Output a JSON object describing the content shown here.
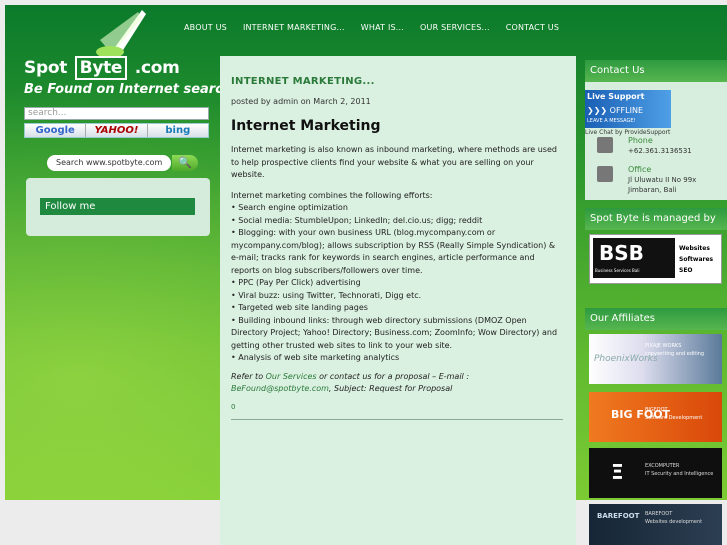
{
  "logo": {
    "word1": "Spot",
    "word2": "Byte",
    "word3": ".com",
    "tagline": "Be Found on Internet searches"
  },
  "search": {
    "placeholder": "search..."
  },
  "engines": [
    "Google",
    "YAHOO!",
    "bing"
  ],
  "site_search": {
    "placeholder": "Search www.spotbyte.com"
  },
  "follow": {
    "label": "Follow me"
  },
  "nav": [
    "ABOUT US",
    "INTERNET MARKETING...",
    "WHAT IS...",
    "OUR SERVICES...",
    "CONTACT US"
  ],
  "post": {
    "title": "INTERNET MARKETING...",
    "meta": "posted by admin on March 2, 2011",
    "heading": "Internet Marketing",
    "intro": "Internet marketing is also known as inbound marketing, where methods are used to help prospective clients find your website & what you are selling on your website.",
    "list_intro": "Internet marketing combines the following efforts:",
    "items": [
      "• Search engine optimization",
      "• Social media: StumbleUpon; LinkedIn; del.cio.us; digg; reddit",
      "• Blogging: with your own business URL (blog.mycompany.com or mycompany.com/blog); allows subscription by RSS (Really Simple Syndication) & e-mail; tracks rank for keywords in search engines, article performance and reports on blog subscribers/followers over time.",
      "• PPC (Pay Per Click) advertising",
      "• Viral buzz: using Twitter, Technorati, Digg etc.",
      "• Targeted web site landing pages",
      "• Building inbound links: through web directory submissions (DMOZ Open Directory Project; Yahoo! Directory; Business.com; ZoomInfo; Wow Directory) and getting other trusted web sites to link to your web site.",
      "• Analysis of web site marketing analytics"
    ],
    "refer_prefix": "Refer to ",
    "refer_link": "Our Services",
    "refer_mid": " or contact us for a proposal – E-mail : ",
    "refer_email": "BeFound@spotbyte.com",
    "refer_suffix": ", Subject: Request for Proposal",
    "comments": "0"
  },
  "contact": {
    "head": "Contact Us",
    "live_title": "Live Support",
    "live_status": "❯❯❯ OFFLINE",
    "live_leave": "LEAVE A MESSAGE!",
    "chat_by": "Live Chat by ProvideSupport",
    "phone_label": "Phone",
    "phone_value": "+62.361.3136531",
    "office_label": "Office",
    "office_line1": "Jl Uluwatu II No 99x",
    "office_line2": "Jimbaran, Bali"
  },
  "managed": {
    "head": "Spot Byte is managed by",
    "logo": "BSB",
    "logo_sub": "Business Services Bali",
    "lines": [
      "Websites",
      "Softwares",
      "SEO"
    ]
  },
  "affiliates": {
    "head": "Our Affiliates",
    "items": [
      {
        "name": "PhoenixWorks",
        "line1": "PIXAJE WORKS",
        "line2": "copywriting and editing",
        "color": "#ffffff"
      },
      {
        "name": "BIG FOOT",
        "line1": "BIGFOOT",
        "line2": "Software Development",
        "color": "#e85a10"
      },
      {
        "name": "EXCOMPUTER",
        "line1": "EXCOMPUTER",
        "line2": "IT Security and Intelligence",
        "color": "#111111"
      },
      {
        "name": "BAREFOOT",
        "line1": "BAREFOOT",
        "line2": "Websites development",
        "color": "#1a2a3a"
      }
    ]
  }
}
